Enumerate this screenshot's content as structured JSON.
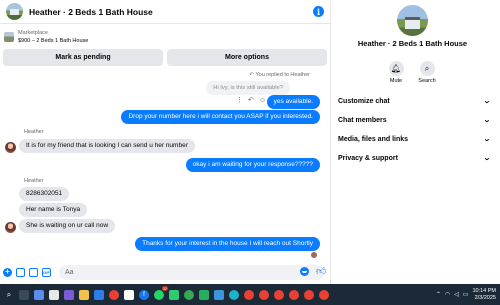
{
  "header": {
    "title": "Heather · 2 Beds 1 Bath House"
  },
  "listing": {
    "label": "Marketplace",
    "price_title": "$900 – 2 Beds 1 Bath House"
  },
  "actions": {
    "pending": "Mark as pending",
    "more": "More options"
  },
  "messages": {
    "reply_note": "You replied to Heather",
    "quoted": "Hi Ivy, is this still available?",
    "m1": "yes available.",
    "m2": "Drop your number here i will contact you ASAP if you interested.",
    "sender1": "Heather",
    "m3": "It is for my friend that is looking I can send u her number",
    "m4": "okay i am waiting for your response?????",
    "sender2": "Heather",
    "m5": "8286302051",
    "m6": "Her name is Tonya",
    "m7": "She is waiting on ur call now",
    "m8": "Thanks for your interest in the house I will reach out Shortly"
  },
  "composer": {
    "placeholder": "Aa"
  },
  "panel": {
    "title": "Heather · 2 Beds 1 Bath House",
    "mute": "Mute",
    "search": "Search",
    "sections": [
      "Customize chat",
      "Chat members",
      "Media, files and links",
      "Privacy & support"
    ]
  },
  "taskbar": {
    "badge": "32",
    "time": "10:14 PM",
    "date": "2/3/2025"
  },
  "colors": {
    "accent": "#0a7cff",
    "bubble_in": "#e4e6eb",
    "taskbar": "#1c2a38"
  }
}
